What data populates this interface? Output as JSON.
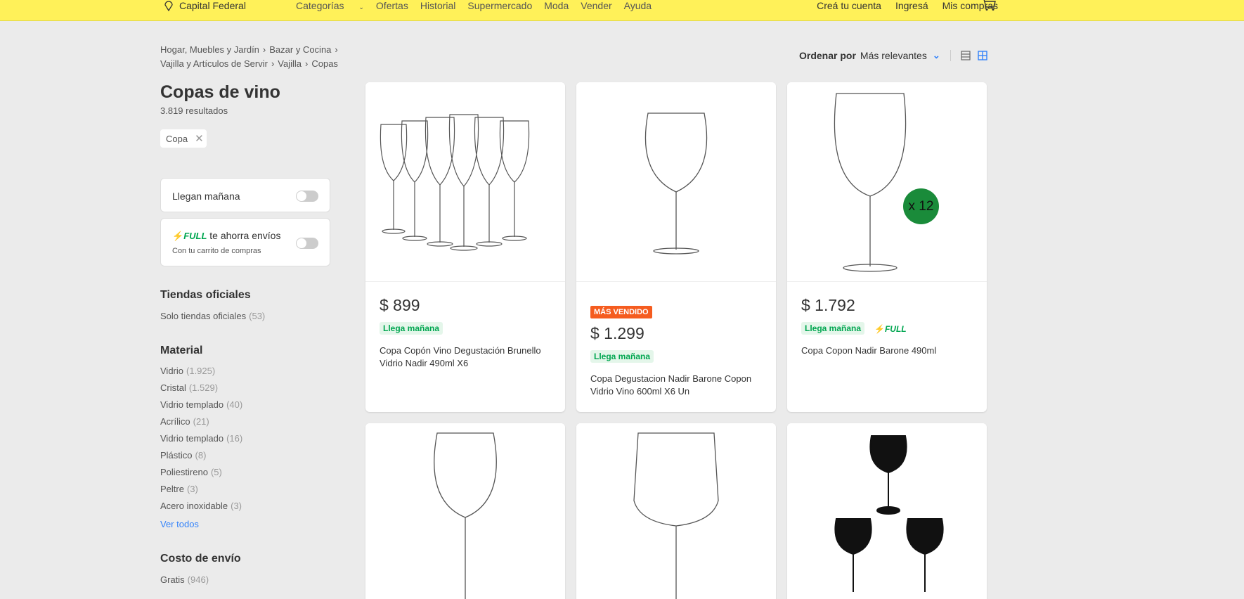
{
  "header": {
    "location": "Capital Federal",
    "nav": [
      "Categorías",
      "Ofertas",
      "Historial",
      "Supermercado",
      "Moda",
      "Vender",
      "Ayuda"
    ],
    "account": [
      "Creá tu cuenta",
      "Ingresá",
      "Mis compras"
    ]
  },
  "breadcrumb": {
    "items": [
      "Hogar, Muebles y Jardín",
      "Bazar y Cocina",
      "Vajilla y Artículos de Servir",
      "Vajilla",
      "Copas"
    ]
  },
  "sort": {
    "label": "Ordenar por",
    "value": "Más relevantes"
  },
  "search": {
    "title": "Copas de vino",
    "results": "3.819 resultados",
    "applied_filter": "Copa"
  },
  "toggles": {
    "tomorrow": "Llegan mañana",
    "full_logo": "FULL",
    "full_text": "te ahorra envíos",
    "full_sub": "Con tu carrito de compras"
  },
  "filters": {
    "official": {
      "title": "Tiendas oficiales",
      "items": [
        {
          "label": "Solo tiendas oficiales",
          "count": "(53)"
        }
      ]
    },
    "material": {
      "title": "Material",
      "items": [
        {
          "label": "Vidrio",
          "count": "(1.925)"
        },
        {
          "label": "Cristal",
          "count": "(1.529)"
        },
        {
          "label": "Vidrio templado",
          "count": "(40)"
        },
        {
          "label": "Acrílico",
          "count": "(21)"
        },
        {
          "label": "Vidrio templado",
          "count": "(16)"
        },
        {
          "label": "Plástico",
          "count": "(8)"
        },
        {
          "label": "Poliestireno",
          "count": "(5)"
        },
        {
          "label": "Peltre",
          "count": "(3)"
        },
        {
          "label": "Acero inoxidable",
          "count": "(3)"
        }
      ],
      "see_all": "Ver todos"
    },
    "shipping": {
      "title": "Costo de envío",
      "items": [
        {
          "label": "Gratis",
          "count": "(946)"
        }
      ]
    }
  },
  "products": [
    {
      "price": "$ 899",
      "arrive": "Llega mañana",
      "title": "Copa Copón Vino Degustación Brunello Vidrio Nadir 490ml X6"
    },
    {
      "badge": "MÁS VENDIDO",
      "price": "$ 1.299",
      "arrive": "Llega mañana",
      "title": "Copa Degustacion Nadir Barone Copon Vidrio Vino 600ml X6 Un"
    },
    {
      "price": "$ 1.792",
      "arrive": "Llega mañana",
      "full": "FULL",
      "title": "Copa Copon Nadir Barone 490ml",
      "pack": "x 12"
    }
  ],
  "colors": {
    "header_bg": "#fff159",
    "link": "#3483fa",
    "green": "#00a650",
    "best_seller": "#f55c1f"
  }
}
